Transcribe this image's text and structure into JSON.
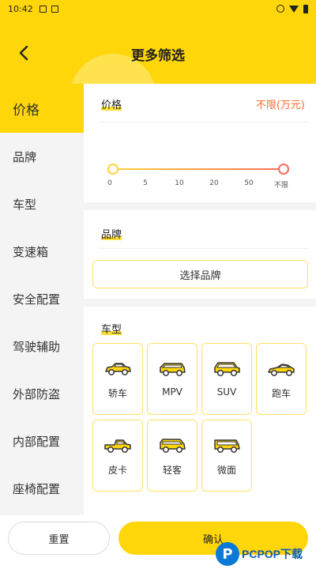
{
  "status_bar": {
    "time": "10:42"
  },
  "header": {
    "title": "更多筛选"
  },
  "sidebar": {
    "items": [
      {
        "label": "价格",
        "active": true
      },
      {
        "label": "品牌"
      },
      {
        "label": "车型"
      },
      {
        "label": "变速箱"
      },
      {
        "label": "安全配置"
      },
      {
        "label": "驾驶辅助"
      },
      {
        "label": "外部防盗"
      },
      {
        "label": "内部配置"
      },
      {
        "label": "座椅配置"
      }
    ]
  },
  "price": {
    "title": "价格",
    "value": "不限(万元)",
    "ticks": [
      "0",
      "5",
      "10",
      "20",
      "50",
      "不限"
    ],
    "range": {
      "min_index": 0,
      "max_index": 5
    }
  },
  "brand": {
    "title": "品牌",
    "button_label": "选择品牌"
  },
  "car_types": {
    "title": "车型",
    "items": [
      {
        "label": "轿车",
        "icon": "sedan-icon"
      },
      {
        "label": "MPV",
        "icon": "mpv-icon"
      },
      {
        "label": "SUV",
        "icon": "suv-icon"
      },
      {
        "label": "跑车",
        "icon": "sports-car-icon"
      },
      {
        "label": "皮卡",
        "icon": "pickup-icon"
      },
      {
        "label": "轻客",
        "icon": "light-bus-icon"
      },
      {
        "label": "微面",
        "icon": "microvan-icon"
      }
    ]
  },
  "footer": {
    "reset_label": "重置",
    "confirm_label": "确认"
  },
  "watermark": {
    "text": "PCPOP下载"
  },
  "colors": {
    "accent": "#ffd60a",
    "price_value": "#ff6a2a",
    "card_border": "#ffe066"
  }
}
